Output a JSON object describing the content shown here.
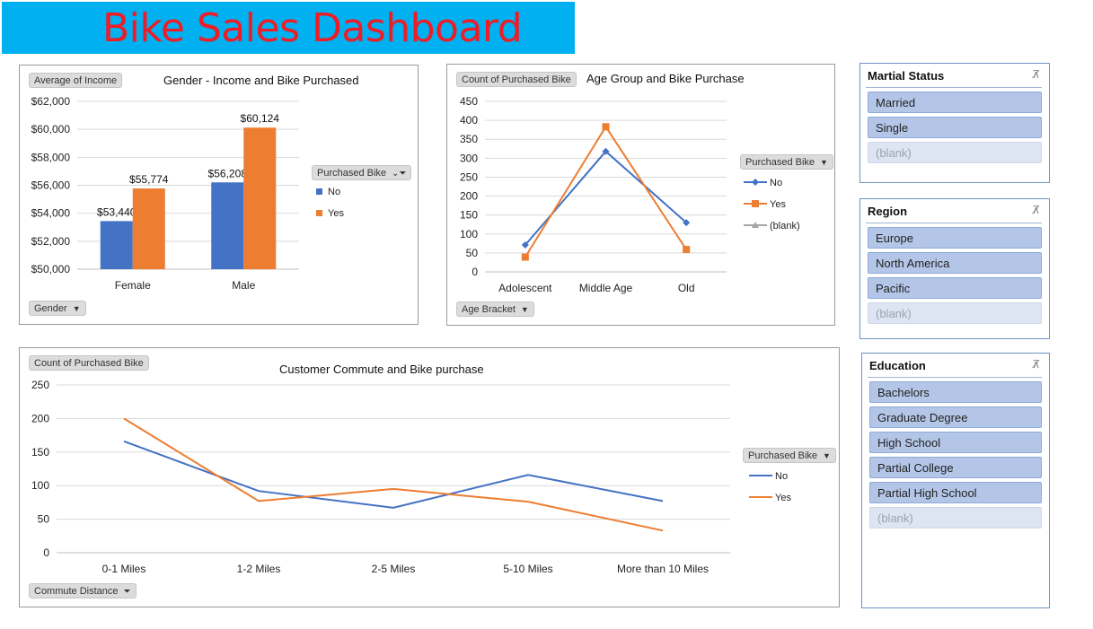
{
  "dashboard_title": "Bike Sales Dashboard",
  "colors": {
    "no": "#4472c4",
    "yes": "#ed7d31",
    "blank": "#a5a5a5",
    "title_bg": "#00b0f0",
    "title_text": "#ee1c25"
  },
  "income_chart": {
    "value_field": "Average of Income",
    "title": "Gender  - Income and Bike Purchased",
    "axis_field": "Gender",
    "legend_field": "Purchased Bike",
    "legend": [
      "No",
      "Yes"
    ],
    "chart_data": {
      "type": "bar",
      "title": "Gender  - Income and Bike Purchased",
      "categories": [
        "Female",
        "Male"
      ],
      "series": [
        {
          "name": "No",
          "values": [
            53440,
            56208
          ]
        },
        {
          "name": "Yes",
          "values": [
            55774,
            60124
          ]
        }
      ],
      "data_labels": [
        [
          "$53,440",
          "$56,208"
        ],
        [
          "$55,774",
          "$60,124"
        ]
      ],
      "ylim": [
        50000,
        62000
      ],
      "yticks": [
        "$50,000",
        "$52,000",
        "$54,000",
        "$56,000",
        "$58,000",
        "$60,000",
        "$62,000"
      ],
      "grid": true,
      "legend": "right"
    }
  },
  "age_chart": {
    "value_field": "Count of Purchased Bike",
    "title": "Age Group and Bike Purchase",
    "axis_field": "Age Bracket",
    "legend_field": "Purchased Bike",
    "legend": [
      "No",
      "Yes",
      "(blank)"
    ],
    "chart_data": {
      "type": "line",
      "title": "Age Group and Bike Purchase",
      "categories": [
        "Adolescent",
        "Middle Age",
        "Old"
      ],
      "series": [
        {
          "name": "No",
          "values": [
            71,
            318,
            130
          ]
        },
        {
          "name": "Yes",
          "values": [
            39,
            383,
            59
          ]
        }
      ],
      "ylim": [
        0,
        450
      ],
      "yticks": [
        "0",
        "50",
        "100",
        "150",
        "200",
        "250",
        "300",
        "350",
        "400",
        "450"
      ],
      "grid": true,
      "legend": "right"
    }
  },
  "commute_chart": {
    "value_field": "Count of Purchased Bike",
    "title": "Customer Commute  and Bike purchase",
    "axis_field": "Commute Distance",
    "legend_field": "Purchased Bike",
    "legend": [
      "No",
      "Yes"
    ],
    "chart_data": {
      "type": "line",
      "title": "Customer Commute  and Bike purchase",
      "categories": [
        "0-1 Miles",
        "1-2 Miles",
        "2-5 Miles",
        "5-10 Miles",
        "More than 10 Miles"
      ],
      "series": [
        {
          "name": "No",
          "values": [
            166,
            92,
            67,
            116,
            77
          ]
        },
        {
          "name": "Yes",
          "values": [
            200,
            77,
            95,
            76,
            33
          ]
        }
      ],
      "ylim": [
        0,
        250
      ],
      "yticks": [
        "0",
        "50",
        "100",
        "150",
        "200",
        "250"
      ],
      "grid": true,
      "legend": "right"
    }
  },
  "slicers": {
    "marital": {
      "title": "Martial Status",
      "items": [
        {
          "label": "Married",
          "active": true
        },
        {
          "label": "Single",
          "active": true
        },
        {
          "label": "(blank)",
          "active": false
        }
      ]
    },
    "region": {
      "title": "Region",
      "items": [
        {
          "label": "Europe",
          "active": true
        },
        {
          "label": "North America",
          "active": true
        },
        {
          "label": "Pacific",
          "active": true
        },
        {
          "label": "(blank)",
          "active": false
        }
      ]
    },
    "education": {
      "title": "Education",
      "items": [
        {
          "label": "Bachelors",
          "active": true
        },
        {
          "label": "Graduate Degree",
          "active": true
        },
        {
          "label": "High School",
          "active": true
        },
        {
          "label": "Partial College",
          "active": true
        },
        {
          "label": "Partial High School",
          "active": true
        },
        {
          "label": "(blank)",
          "active": false
        }
      ]
    }
  }
}
